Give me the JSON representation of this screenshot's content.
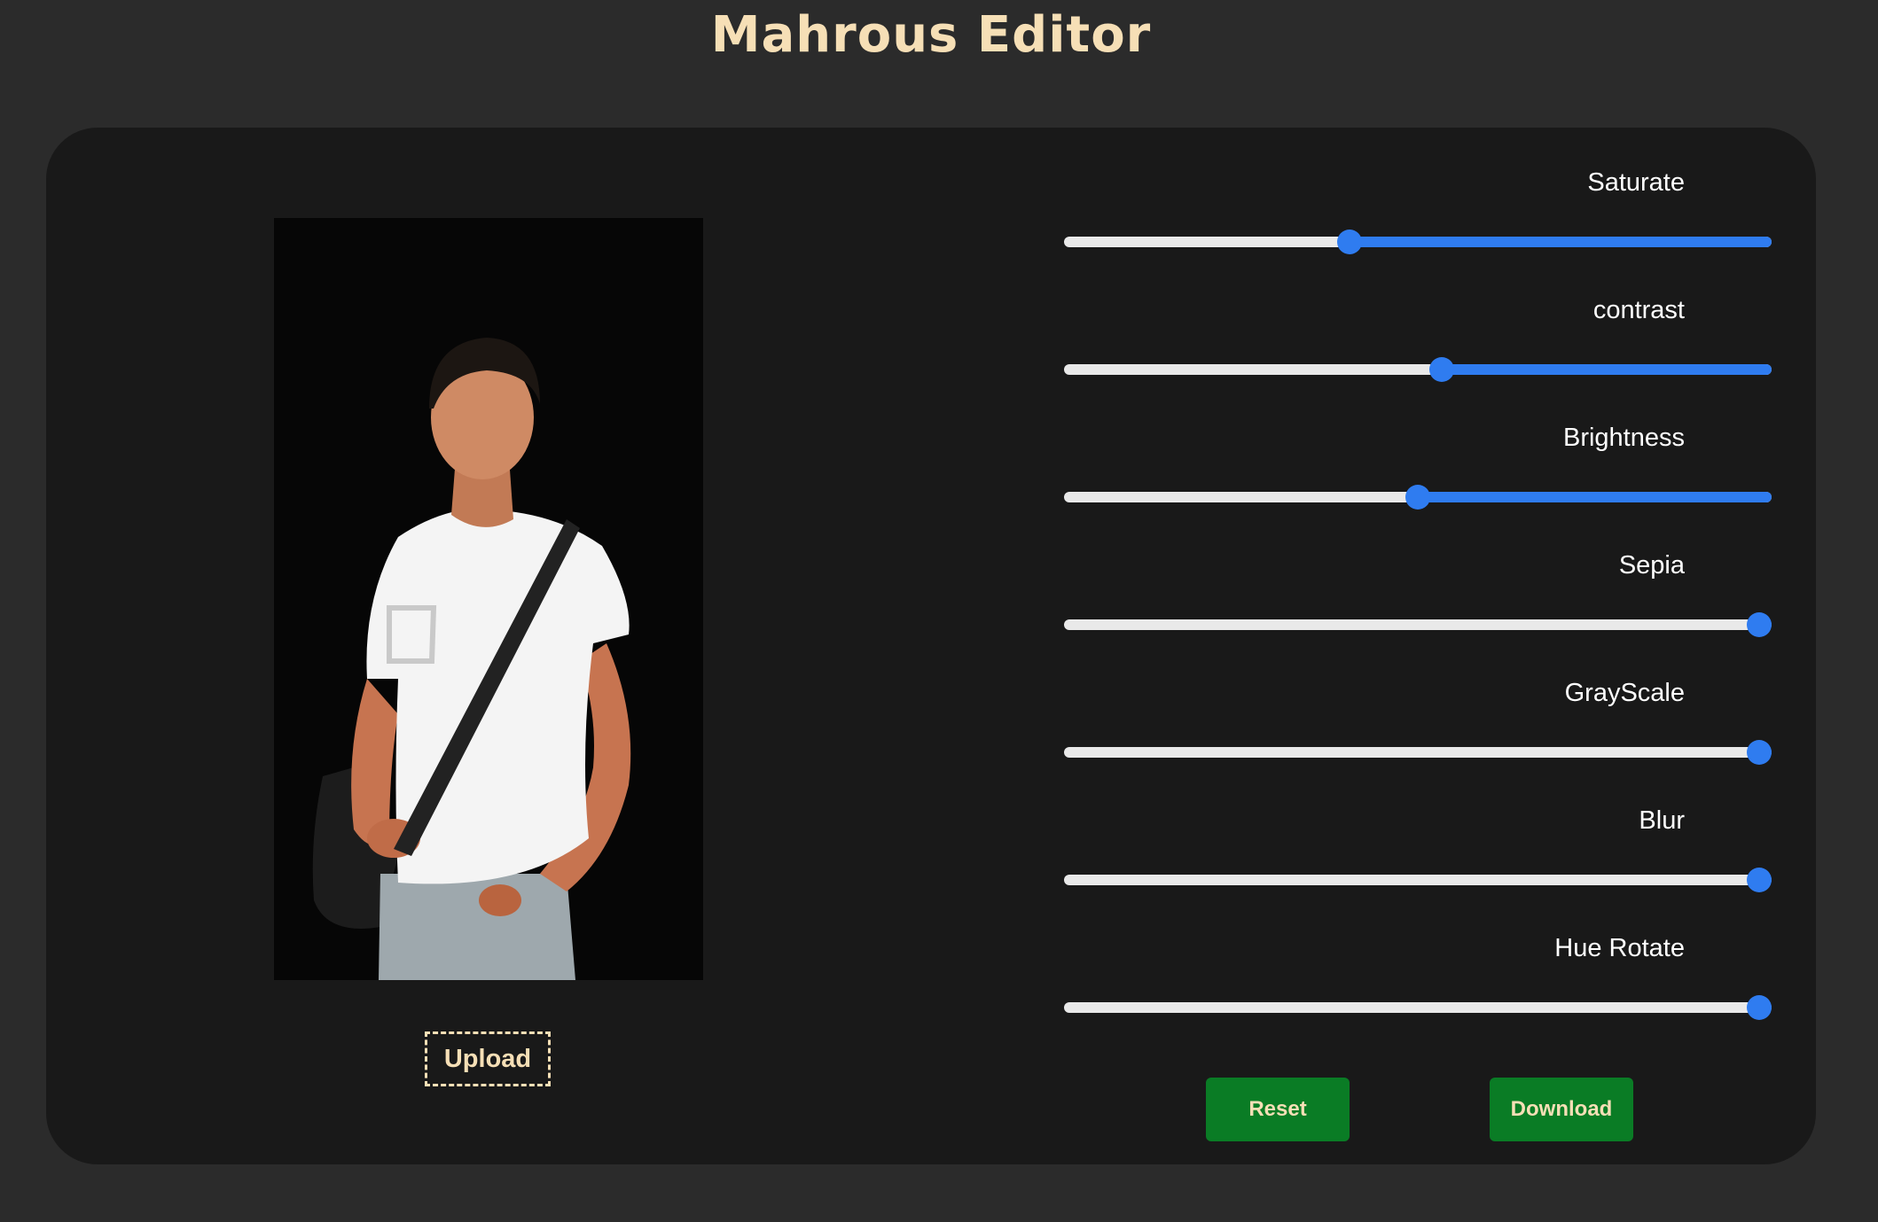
{
  "app": {
    "title": "Mahrous Editor"
  },
  "preview": {
    "alt": "Edited photo preview"
  },
  "upload": {
    "label": "Upload"
  },
  "filters": [
    {
      "label": "Saturate",
      "value": 0.4
    },
    {
      "label": "contrast",
      "value": 0.535
    },
    {
      "label": "Brightness",
      "value": 0.5
    },
    {
      "label": "Sepia",
      "value": 1.0
    },
    {
      "label": "GrayScale",
      "value": 1.0
    },
    {
      "label": "Blur",
      "value": 1.0
    },
    {
      "label": "Hue Rotate",
      "value": 1.0
    }
  ],
  "actions": {
    "reset_label": "Reset",
    "download_label": "Download"
  },
  "colors": {
    "page_background": "#2b2b2b",
    "card_background": "#191919",
    "accent_text": "#f6dfb6",
    "slider_fill": "#2f7cf0",
    "slider_track": "#e9e9e9",
    "button_background": "#0a7c25"
  }
}
